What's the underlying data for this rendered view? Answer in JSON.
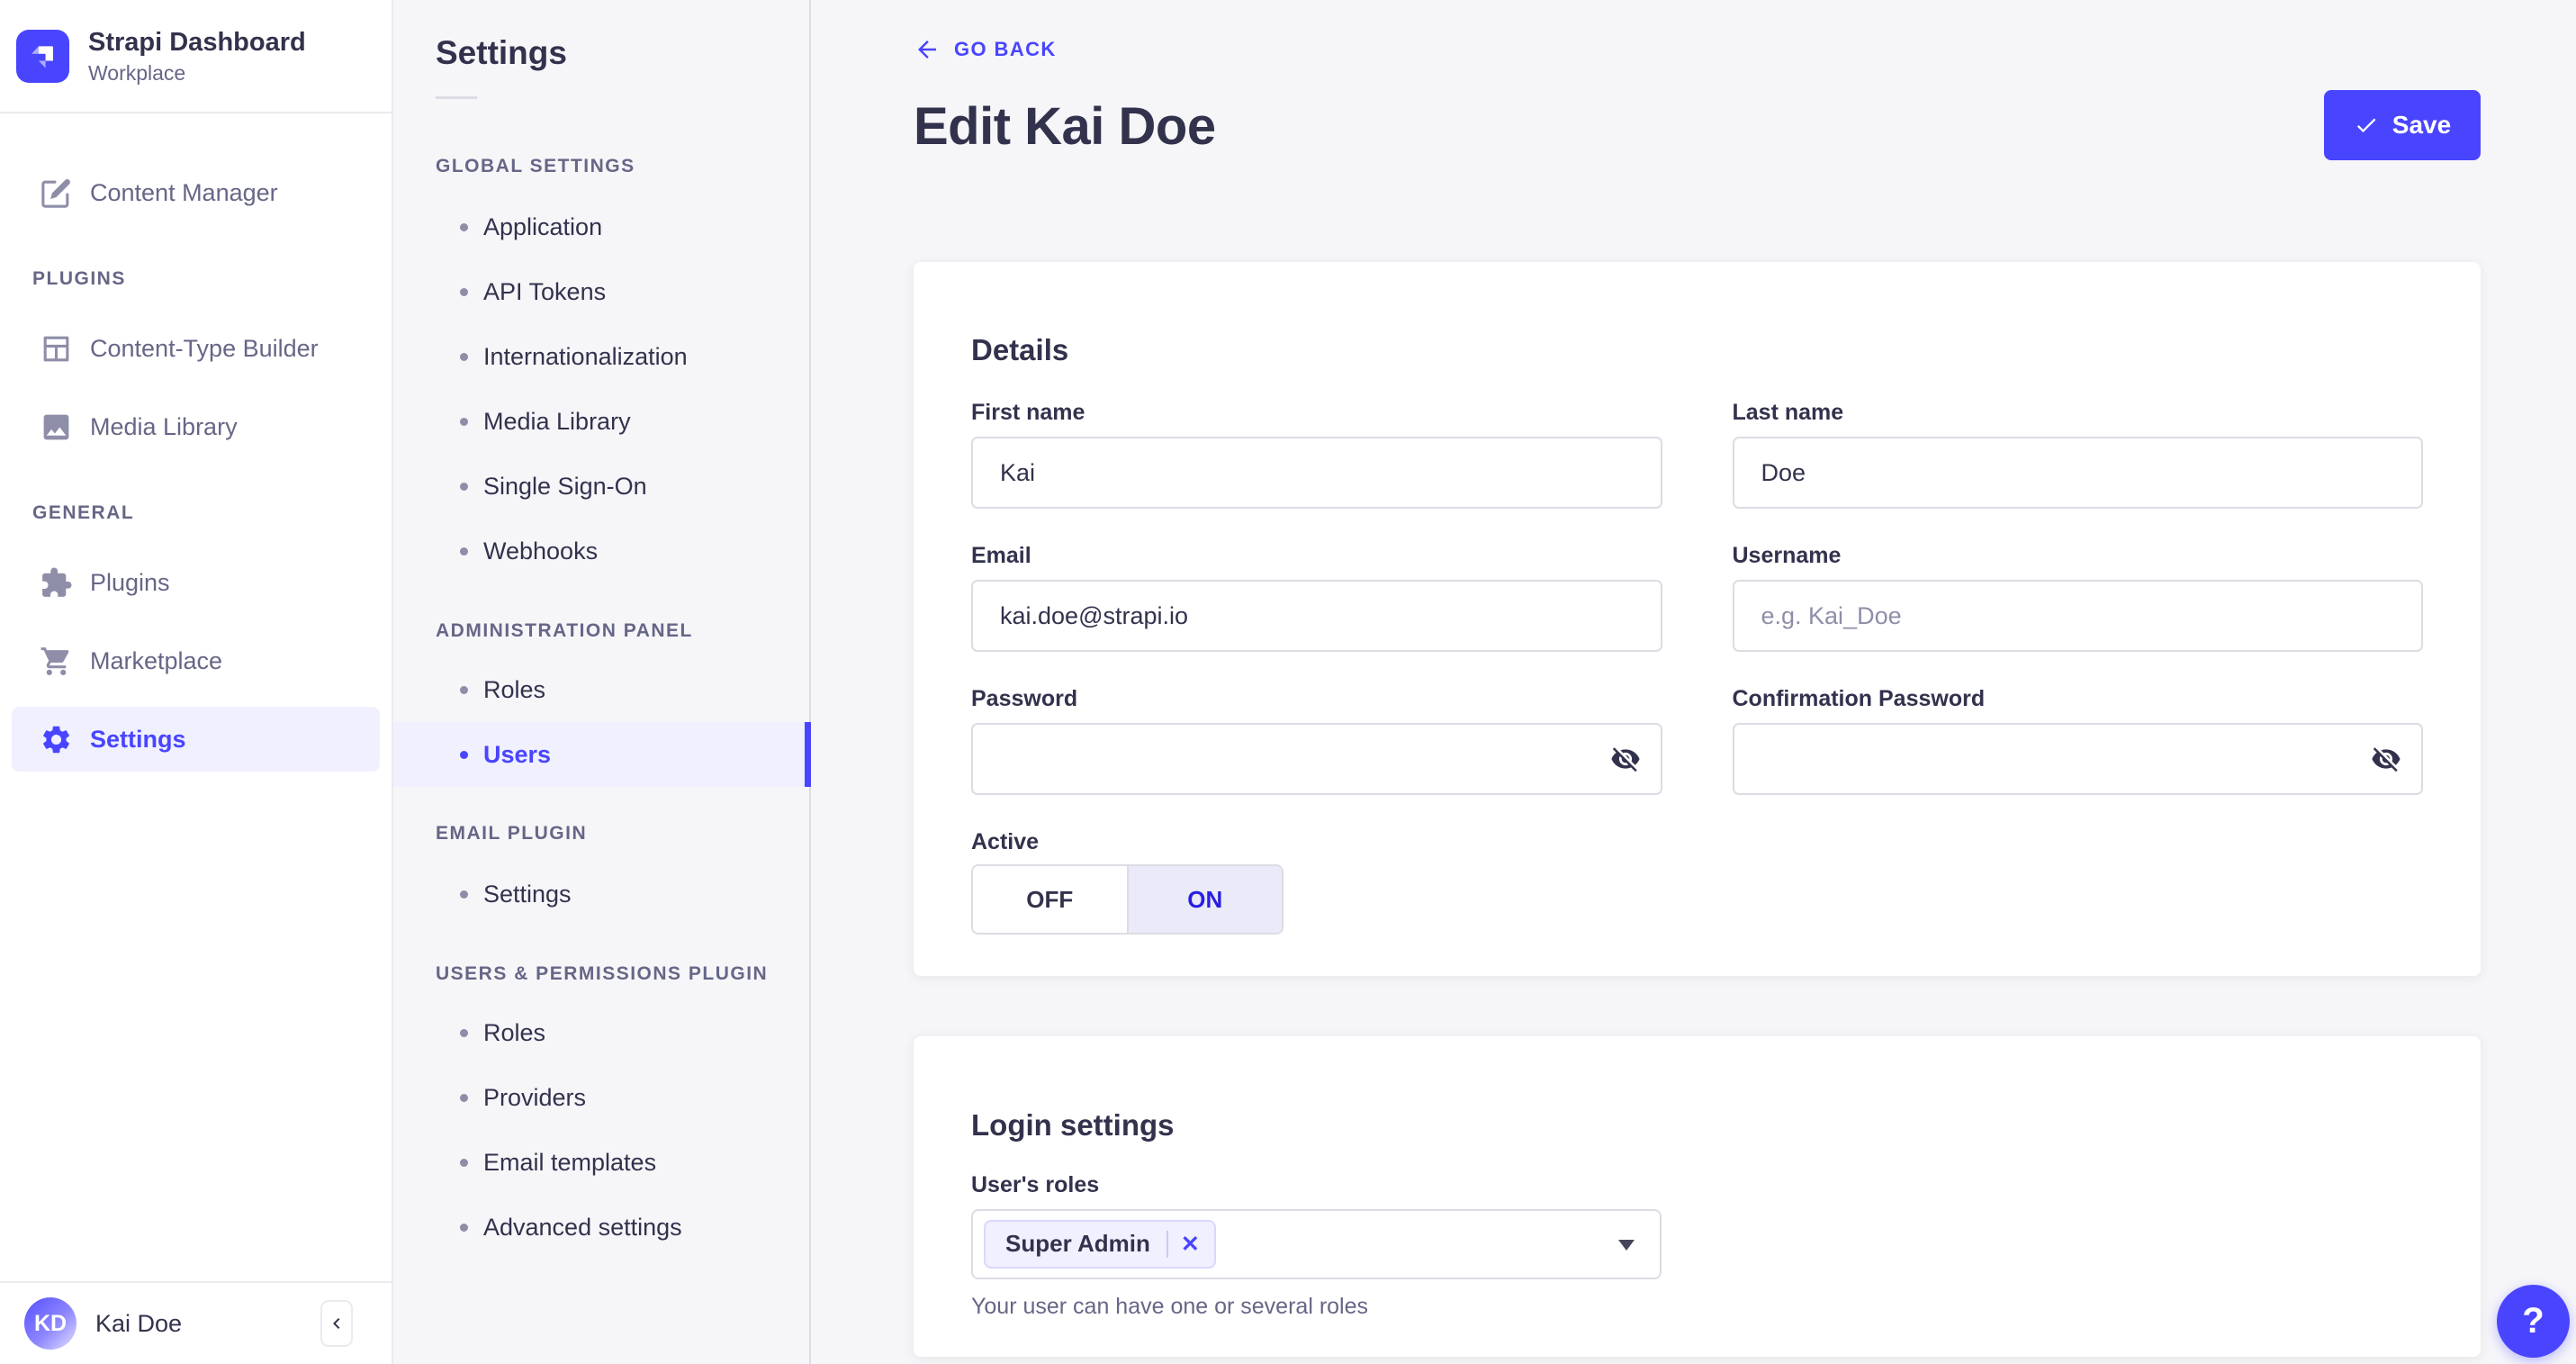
{
  "colors": {
    "primary": "#4945ff",
    "primary_text_active": "#271fe0",
    "active_bg": "#f0f0ff",
    "text": "#32324d",
    "muted": "#666687",
    "border": "#dcdce4"
  },
  "sidebar": {
    "brand": {
      "title": "Strapi Dashboard",
      "subtitle": "Workplace"
    },
    "groups": [
      {
        "items": [
          {
            "label": "Content Manager",
            "icon": "feather-icon"
          }
        ]
      },
      {
        "header": "PLUGINS",
        "items": [
          {
            "label": "Content-Type Builder",
            "icon": "layout-icon"
          },
          {
            "label": "Media Library",
            "icon": "image-icon"
          }
        ]
      },
      {
        "header": "GENERAL",
        "items": [
          {
            "label": "Plugins",
            "icon": "puzzle-icon"
          },
          {
            "label": "Marketplace",
            "icon": "cart-icon"
          },
          {
            "label": "Settings",
            "icon": "gear-icon",
            "active": true
          }
        ]
      }
    ],
    "user": {
      "initials": "KD",
      "name": "Kai Doe"
    }
  },
  "subnav": {
    "title": "Settings",
    "sections": [
      {
        "header": "GLOBAL SETTINGS",
        "items": [
          {
            "label": "Application"
          },
          {
            "label": "API Tokens"
          },
          {
            "label": "Internationalization"
          },
          {
            "label": "Media Library"
          },
          {
            "label": "Single Sign-On"
          },
          {
            "label": "Webhooks"
          }
        ]
      },
      {
        "header": "ADMINISTRATION PANEL",
        "items": [
          {
            "label": "Roles"
          },
          {
            "label": "Users",
            "active": true
          }
        ]
      },
      {
        "header": "EMAIL PLUGIN",
        "items": [
          {
            "label": "Settings"
          }
        ]
      },
      {
        "header": "USERS & PERMISSIONS PLUGIN",
        "items": [
          {
            "label": "Roles"
          },
          {
            "label": "Providers"
          },
          {
            "label": "Email templates"
          },
          {
            "label": "Advanced settings"
          }
        ]
      }
    ]
  },
  "main": {
    "back_label": "GO BACK",
    "title": "Edit Kai Doe",
    "save_label": "Save",
    "details": {
      "heading": "Details",
      "fields": {
        "first_name": {
          "label": "First name",
          "value": "Kai"
        },
        "last_name": {
          "label": "Last name",
          "value": "Doe"
        },
        "email": {
          "label": "Email",
          "value": "kai.doe@strapi.io"
        },
        "username": {
          "label": "Username",
          "value": "",
          "placeholder": "e.g. Kai_Doe"
        },
        "password": {
          "label": "Password",
          "value": ""
        },
        "confirmation_password": {
          "label": "Confirmation Password",
          "value": ""
        }
      },
      "active_toggle": {
        "label": "Active",
        "off": "OFF",
        "on": "ON",
        "selected": "ON"
      }
    },
    "login": {
      "heading": "Login settings",
      "roles_label": "User's roles",
      "selected_roles": [
        "Super Admin"
      ],
      "remove_label": "✕",
      "hint": "Your user can have one or several roles"
    },
    "help_label": "?"
  }
}
